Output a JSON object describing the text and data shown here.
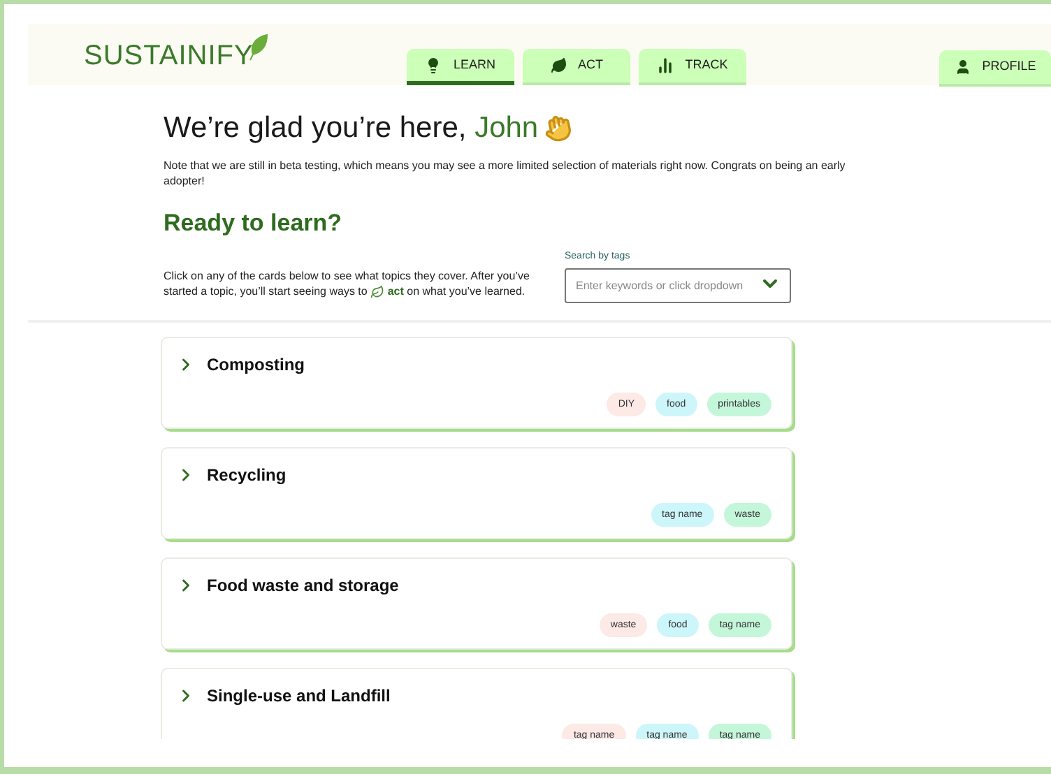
{
  "header": {
    "logo": "SUSTAINIFY",
    "tabs": [
      {
        "label": "LEARN",
        "kind": "bulb",
        "selected": true
      },
      {
        "label": "ACT",
        "kind": "leaf",
        "selected": false
      },
      {
        "label": "TRACK",
        "kind": "chart",
        "selected": false
      }
    ],
    "profile": {
      "label": "PROFILE"
    }
  },
  "greeting": {
    "text": "We’re glad you’re here, ",
    "name": "John"
  },
  "note": "Note that we are still in beta testing, which means you may see a more limited selection of materials right now. Congrats on being an early adopter!",
  "section": {
    "title": "Ready to learn?",
    "intro_before": "Click on any of the cards below to see what topics they cover. After you’ve started a topic, you’ll start seeing ways to",
    "intro_link": "act",
    "intro_after": "on what you’ve learned."
  },
  "search": {
    "label": "Search by tags",
    "placeholder": "Enter keywords or click dropdown"
  },
  "cards": [
    {
      "title": "Composting",
      "tags": [
        {
          "label": "DIY",
          "color": "#fde9e6"
        },
        {
          "label": "food",
          "color": "#cdf6fb"
        },
        {
          "label": "printables",
          "color": "#c4f7da"
        }
      ]
    },
    {
      "title": "Recycling",
      "tags": [
        {
          "label": "tag name",
          "color": "#cdf6fb"
        },
        {
          "label": "waste",
          "color": "#c4f7da"
        }
      ]
    },
    {
      "title": "Food waste and storage",
      "tags": [
        {
          "label": "waste",
          "color": "#fde9e6"
        },
        {
          "label": "food",
          "color": "#cdf6fb"
        },
        {
          "label": "tag name",
          "color": "#c4f7da"
        }
      ]
    },
    {
      "title": "Single-use and Landfill",
      "tags": [
        {
          "label": "tag name",
          "color": "#fde9e6"
        },
        {
          "label": "tag name",
          "color": "#cdf6fb"
        },
        {
          "label": "tag name",
          "color": "#c4f7da"
        }
      ]
    }
  ]
}
